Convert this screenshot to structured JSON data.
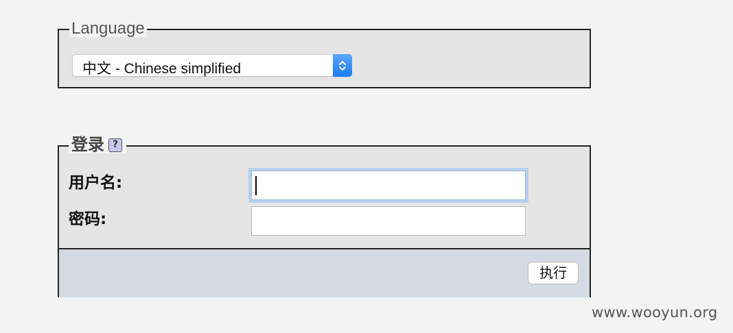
{
  "language_section": {
    "legend": "Language",
    "selected_language": "中文 - Chinese simplified",
    "select_icon": "up-down-chevron-icon"
  },
  "login_section": {
    "legend": "登录",
    "help_icon": "help-icon",
    "help_glyph": "?",
    "username_label": "用户名:",
    "username_value": "",
    "password_label": "密码:",
    "password_value": "",
    "submit_label": "执行"
  },
  "watermark": "www.wooyun.org",
  "colors": {
    "page_bg": "#f3f3f3",
    "fieldset_bg": "#e5e5e5",
    "footer_bg": "#d3dae2",
    "select_accent": "#1a7cf0",
    "focus_ring": "#b6d0ee"
  }
}
